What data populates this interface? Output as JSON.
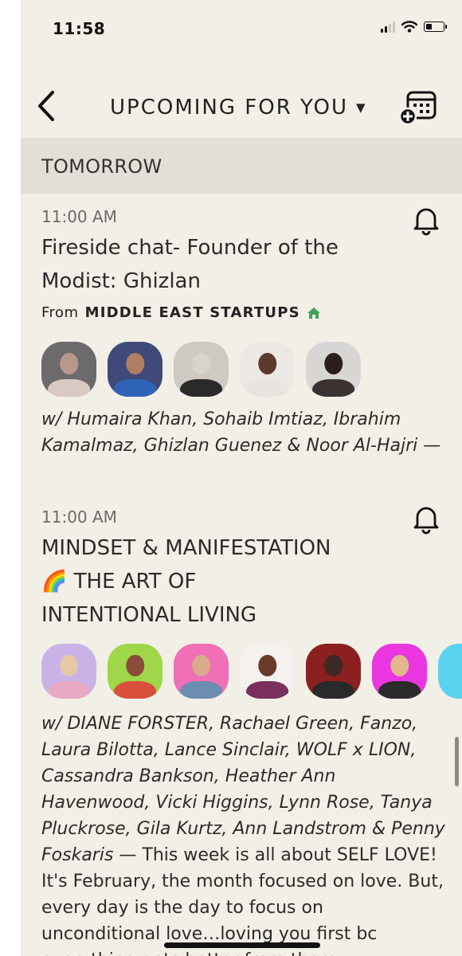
{
  "status_bar": {
    "time": "11:58"
  },
  "header": {
    "title": "UPCOMING FOR YOU",
    "caret": "▼"
  },
  "section": {
    "label": "TOMORROW"
  },
  "events": [
    {
      "time": "11:00 AM",
      "title_lines": [
        "Fireside chat- Founder of the",
        "Modist: Ghizlan"
      ],
      "from_prefix": "From",
      "club": "MIDDLE EAST STARTUPS",
      "with_text": "w/ Humaira Khan, Sohaib Imtiaz, Ibrahim Kamalmaz, Ghizlan Guenez & Noor Al-Hajri —",
      "avatars": [
        {
          "bg": "#6d6a6e",
          "head": "#b8988a",
          "body": "#d9c9c3"
        },
        {
          "bg": "#3f4a7a",
          "head": "#b07f62",
          "body": "#2f63b8"
        },
        {
          "bg": "#cfc9c3",
          "head": "#d8d3cd",
          "body": "#2a2a2a"
        },
        {
          "bg": "#ece8e4",
          "head": "#5a3a2c",
          "body": "#e9e4df"
        },
        {
          "bg": "#d8d6d4",
          "head": "#2a1f1c",
          "body": "#3a3230"
        }
      ]
    },
    {
      "time": "11:00 AM",
      "title_lines": [
        "MINDSET & MANIFESTATION",
        "🌈 THE ART OF",
        "INTENTIONAL LIVING"
      ],
      "with_text": "w/ DIANE FORSTER, Rachael Green, Fanzo, Laura Bilotta, Lance Sinclair, WOLF x LION, Cassandra Bankson, Heather Ann Havenwood, Vicki Higgins, Lynn Rose, Tanya Pluckrose, Gila Kurtz, Ann Landstrom & Penny Foskaris —",
      "description": " This week is all about SELF LOVE! It's February, the month focused on love. But, every day is the day to focus on unconditional love…loving you first bc everything gets better from there.",
      "avatars": [
        {
          "bg": "#c9b2e6",
          "head": "#e6c7a6",
          "body": "#e8a9c4"
        },
        {
          "bg": "#9fd64a",
          "head": "#8a4b3a",
          "body": "#d9503c"
        },
        {
          "bg": "#f06fb7",
          "head": "#d9aa8c",
          "body": "#6c8db0"
        },
        {
          "bg": "#f4f1ee",
          "head": "#6a3a2a",
          "body": "#7a2f5f"
        },
        {
          "bg": "#8c1f1f",
          "head": "#3c2a22",
          "body": "#2a2a2a"
        },
        {
          "bg": "#e936e0",
          "head": "#e2b58c",
          "body": "#2b2b2b"
        },
        {
          "bg": "#5bd3f0",
          "head": "#5bd3f0",
          "body": "#5bd3f0"
        }
      ]
    }
  ]
}
